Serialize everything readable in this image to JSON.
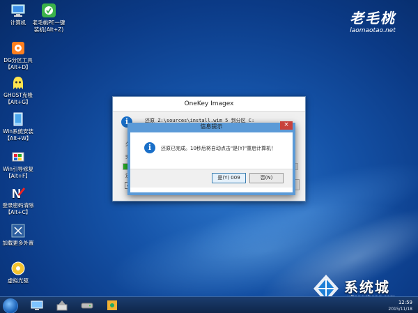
{
  "desktop": {
    "icons": [
      {
        "label": "计算机",
        "icon": "computer-icon"
      },
      {
        "label": "老毛桃PE一键\n装机(Alt+Z)",
        "icon": "pe-install-icon"
      },
      {
        "label": "DG分区工具\n【Alt+D】",
        "icon": "diskgenius-icon"
      },
      {
        "label": "GHOST克隆\n【Alt+G】",
        "icon": "ghost-icon"
      },
      {
        "label": "Win系统安装\n【Alt+W】",
        "icon": "windows-install-icon"
      },
      {
        "label": "Win引导修复\n【Alt+F】",
        "icon": "boot-repair-icon"
      },
      {
        "label": "登录密码清除\n【Alt+C】",
        "icon": "password-clear-icon"
      },
      {
        "label": "加载更多外置",
        "icon": "load-external-icon"
      },
      {
        "label": "虚拟光驱",
        "icon": "virtual-drive-icon"
      }
    ],
    "brand": {
      "logo_text": "老毛桃",
      "url": "laomaotao.net"
    }
  },
  "onekey_window": {
    "title": "OneKey Imagex",
    "restore_text": "还原 Z:\\sources\\install.wim 5 到分区 C:",
    "status_fragments": [
      "久",
      "完",
      "还"
    ],
    "progress_fraction": 0.95,
    "checkbox_checked": true
  },
  "message_dialog": {
    "title": "信息提示",
    "message": "还原已完成。10秒后将自动点击\"是(Y)\"重启计算机！",
    "yes_button": "是(Y) 009",
    "no_button": "否(N)",
    "close_glyph": "×"
  },
  "taskbar": {
    "clock_time": "12:59",
    "clock_date": "2015/11/18"
  },
  "watermark": {
    "text": "系统城",
    "url": "xitongcheng.com"
  },
  "colors": {
    "accent": "#5b9ad7",
    "close_red": "#c8413b",
    "progress_green": "#2cb32c",
    "desktop_blue": "#1553a8"
  }
}
